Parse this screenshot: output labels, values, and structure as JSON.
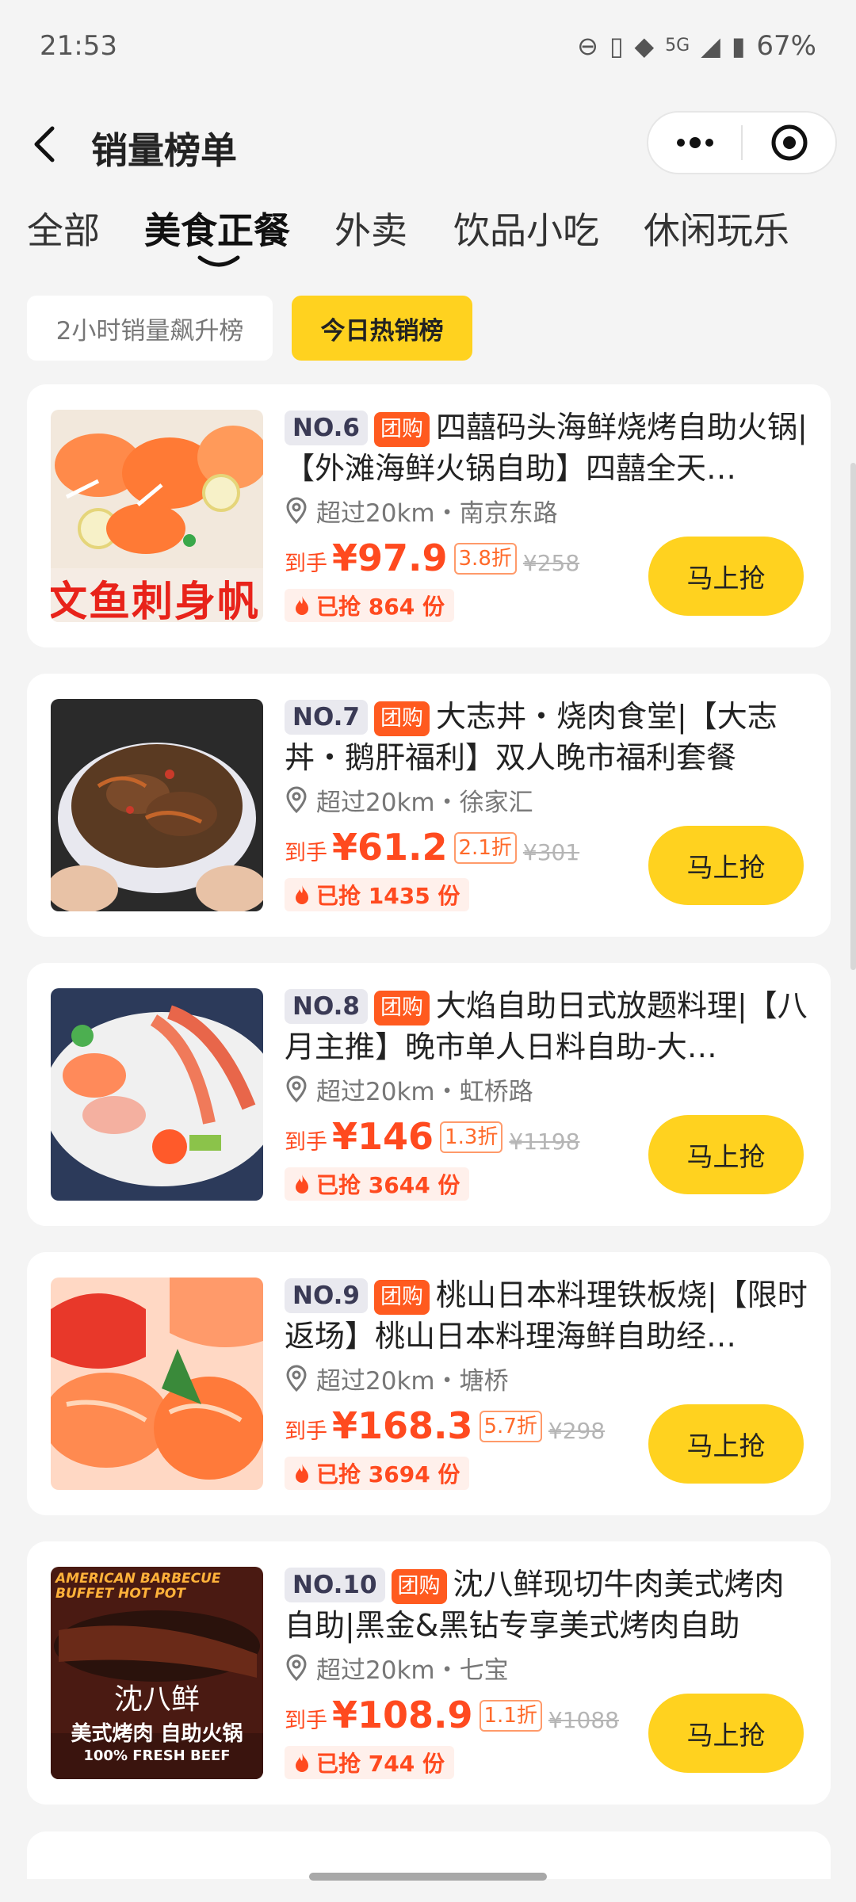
{
  "status": {
    "time": "21:53",
    "network": "5G",
    "battery": "67%"
  },
  "nav": {
    "title": "销量榜单"
  },
  "tabs": [
    {
      "label": "全部"
    },
    {
      "label": "美食正餐",
      "active": true
    },
    {
      "label": "外卖"
    },
    {
      "label": "饮品小吃"
    },
    {
      "label": "休闲玩乐"
    }
  ],
  "filters": {
    "rising": "2小时销量飙升榜",
    "today": "今日热销榜"
  },
  "labels": {
    "price_prefix": "到手",
    "buy": "马上抢",
    "tuan": "团购"
  },
  "items": [
    {
      "rank": "NO.6",
      "title": "四囍码头海鲜烧烤自助火锅|【外滩海鲜火锅自助】四囍全天…",
      "location": "超过20km・南京东路",
      "price": "¥97.9",
      "discount": "3.8折",
      "original": "¥258",
      "sold": "已抢 864 份",
      "thumb_text": "文鱼刺身帆"
    },
    {
      "rank": "NO.7",
      "title": "大志丼・烧肉食堂|【大志丼・鹅肝福利】双人晚市福利套餐",
      "location": "超过20km・徐家汇",
      "price": "¥61.2",
      "discount": "2.1折",
      "original": "¥301",
      "sold": "已抢 1435 份"
    },
    {
      "rank": "NO.8",
      "title": "大焰自助日式放题料理|【八月主推】晚市单人日料自助-大…",
      "location": "超过20km・虹桥路",
      "price": "¥146",
      "discount": "1.3折",
      "original": "¥1198",
      "sold": "已抢 3644 份"
    },
    {
      "rank": "NO.9",
      "title": "桃山日本料理铁板烧|【限时返场】桃山日本料理海鲜自助经…",
      "location": "超过20km・塘桥",
      "price": "¥168.3",
      "discount": "5.7折",
      "original": "¥298",
      "sold": "已抢 3694 份"
    },
    {
      "rank": "NO.10",
      "title": "沈八鲜现切牛肉美式烤肉自助|黑金&黑钻专享美式烤肉自助",
      "location": "超过20km・七宝",
      "price": "¥108.9",
      "discount": "1.1折",
      "original": "¥1088",
      "sold": "已抢 744 份",
      "thumb_text_top": "AMERICAN BARBECUE BUFFET HOT POT",
      "thumb_text_brand": "沈八鲜",
      "thumb_text_main": "美式烤肉 自助火锅",
      "thumb_text_sub": "100% FRESH BEEF"
    }
  ]
}
